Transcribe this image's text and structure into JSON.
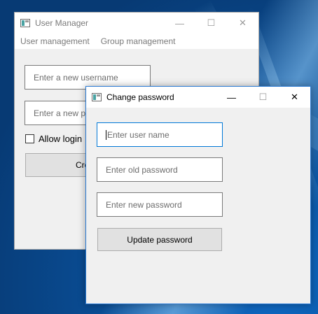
{
  "background_window": {
    "title": "User Manager",
    "controls": {
      "minimize": "—",
      "maximize": "☐",
      "close": "✕"
    },
    "menu": [
      "User management",
      "Group management"
    ],
    "username_input": {
      "placeholder": "Enter a new username"
    },
    "password_input": {
      "placeholder": "Enter a new password"
    },
    "allow_login_label": "Allow login",
    "create_button_label": "Create"
  },
  "dialog": {
    "title": "Change password",
    "controls": {
      "minimize": "—",
      "maximize": "☐",
      "close": "✕"
    },
    "user_name_input": {
      "placeholder": "Enter user name"
    },
    "old_password_input": {
      "placeholder": "Enter old password"
    },
    "new_password_input": {
      "placeholder": "Enter new password"
    },
    "update_button_label": "Update password"
  },
  "colors": {
    "accent_border": "#0078d7",
    "window_bg": "#f0f0f0",
    "desktop": "#0a4a8c"
  }
}
